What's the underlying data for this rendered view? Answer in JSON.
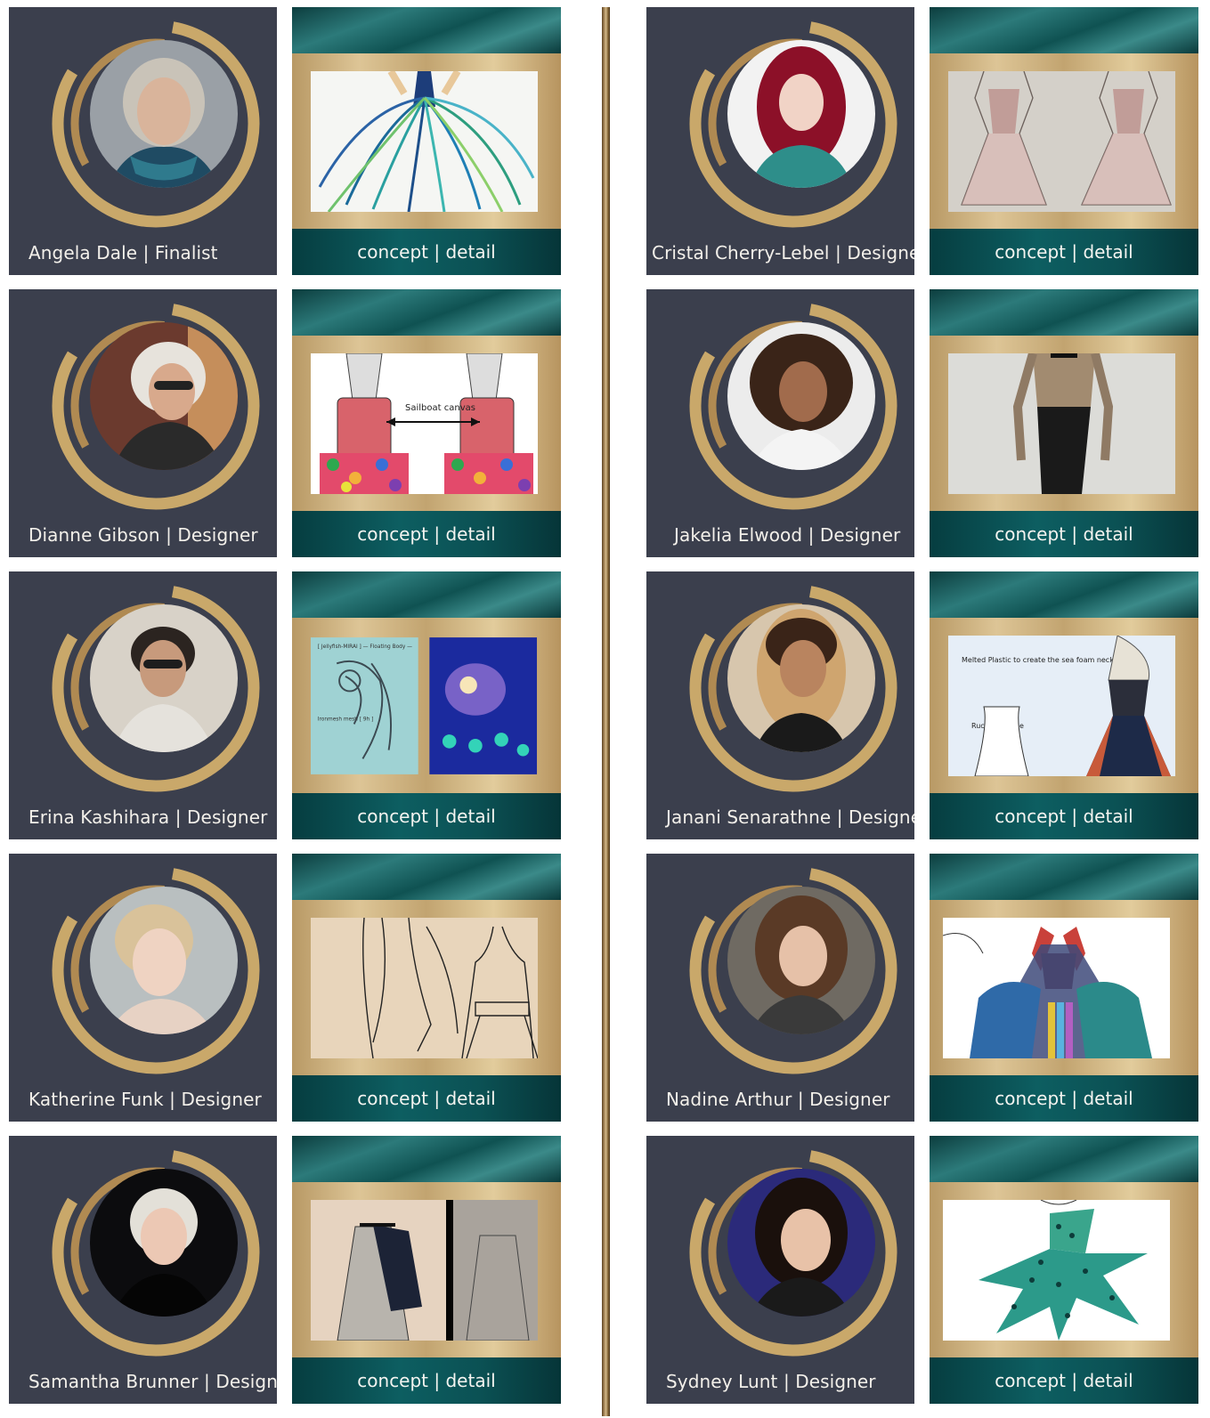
{
  "colors": {
    "card_bg": "#3b3f4d",
    "gold": "#c9a86a",
    "teal": "#0d5e61",
    "divider": "#a9885a"
  },
  "link_label": "concept | detail",
  "left_column": [
    {
      "name": "Angela Dale | Finalist",
      "portrait": "gray-haired-woman-teal-scarf",
      "art": "teal-tentacle-gown-sketch"
    },
    {
      "name": "Dianne Gibson | Designer",
      "portrait": "blonde-woman-sunglasses",
      "art": "corset-dress-sketches"
    },
    {
      "name": "Erina Kashihara | Designer",
      "portrait": "woman-glasses-short-hair",
      "art": "jellyfish-sketch-and-photo"
    },
    {
      "name": "Katherine Funk | Designer",
      "portrait": "blonde-woman-looking-down",
      "art": "pencil-dress-sketch"
    },
    {
      "name": "Samantha Brunner | Designer",
      "portrait": "blonde-woman-black-top",
      "art": "dark-jacket-sketch"
    }
  ],
  "right_column": [
    {
      "name": "Cristal Cherry-Lebel | Designer",
      "portrait": "red-haired-woman-teal-dress",
      "art": "pink-dress-sketch"
    },
    {
      "name": "Jakelia Elwood | Designer",
      "portrait": "curly-haired-woman-white-top",
      "art": "lace-top-skirt-sketch"
    },
    {
      "name": "Janani Senarathne | Designer",
      "portrait": "woman-ombre-hair",
      "art": "sea-foam-gown-sketch"
    },
    {
      "name": "Nadine Arthur | Designer",
      "portrait": "brown-haired-woman-smiling",
      "art": "colorful-cape-gown-sketch"
    },
    {
      "name": "Sydney Lunt | Designer",
      "portrait": "dark-haired-woman-smiling",
      "art": "green-spotted-dress-sketch"
    }
  ],
  "art_text": {
    "corset_note": "Sailboat canvas",
    "jelly_title": "[ Jellyfish-MIRAI ] — Floating Body —",
    "jelly_note": "Ironmesh mesh [ 9h ]",
    "seafoam_note": "Melted Plastic to create the sea foam neck detail",
    "ruched_note": "Ruched bodice"
  }
}
